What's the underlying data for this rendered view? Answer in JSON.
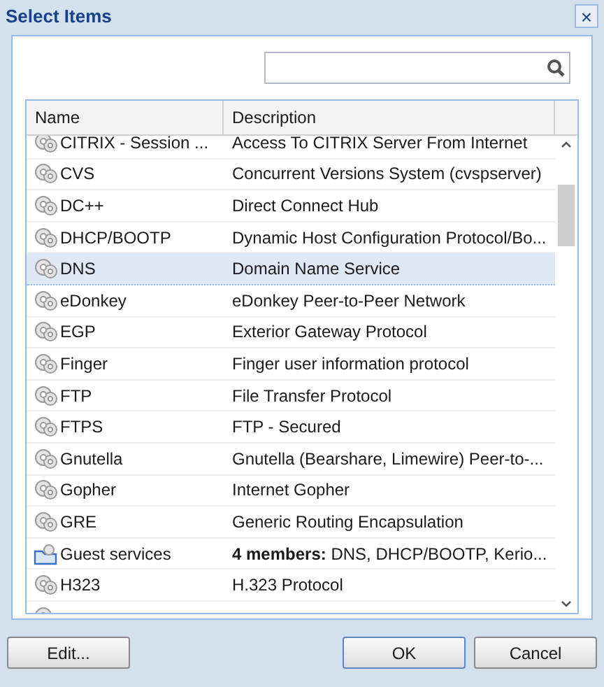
{
  "window": {
    "title": "Select Items",
    "close": "×"
  },
  "table": {
    "columns": [
      "Name",
      "Description"
    ],
    "rows": [
      {
        "kind": "service",
        "name": "CITRIX - Session ...",
        "description": "Access To CITRIX Server From Internet",
        "selected": false
      },
      {
        "kind": "service",
        "name": "CVS",
        "description": "Concurrent Versions System (cvspserver)",
        "selected": false
      },
      {
        "kind": "service",
        "name": "DC++",
        "description": "Direct Connect Hub",
        "selected": false
      },
      {
        "kind": "service",
        "name": "DHCP/BOOTP",
        "description": "Dynamic Host Configuration Protocol/Bo...",
        "selected": false
      },
      {
        "kind": "service",
        "name": "DNS",
        "description": "Domain Name Service",
        "selected": true
      },
      {
        "kind": "service",
        "name": "eDonkey",
        "description": "eDonkey Peer-to-Peer Network",
        "selected": false
      },
      {
        "kind": "service",
        "name": "EGP",
        "description": "Exterior Gateway Protocol",
        "selected": false
      },
      {
        "kind": "service",
        "name": "Finger",
        "description": "Finger user information protocol",
        "selected": false
      },
      {
        "kind": "service",
        "name": "FTP",
        "description": "File Transfer Protocol",
        "selected": false
      },
      {
        "kind": "service",
        "name": "FTPS",
        "description": "FTP - Secured",
        "selected": false
      },
      {
        "kind": "service",
        "name": "Gnutella",
        "description": "Gnutella (Bearshare, Limewire) Peer-to-...",
        "selected": false
      },
      {
        "kind": "service",
        "name": "Gopher",
        "description": "Internet Gopher",
        "selected": false
      },
      {
        "kind": "service",
        "name": "GRE",
        "description": "Generic Routing Encapsulation",
        "selected": false
      },
      {
        "kind": "group",
        "name": "Guest services",
        "description": "**4 members:**  DNS, DHCP/BOOTP, Kerio...",
        "selected": false
      },
      {
        "kind": "service",
        "name": "H323",
        "description": "H.323 Protocol",
        "selected": false
      }
    ]
  },
  "buttons": {
    "left": [
      "Edit..."
    ],
    "right": [
      "OK",
      "Cancel"
    ]
  }
}
